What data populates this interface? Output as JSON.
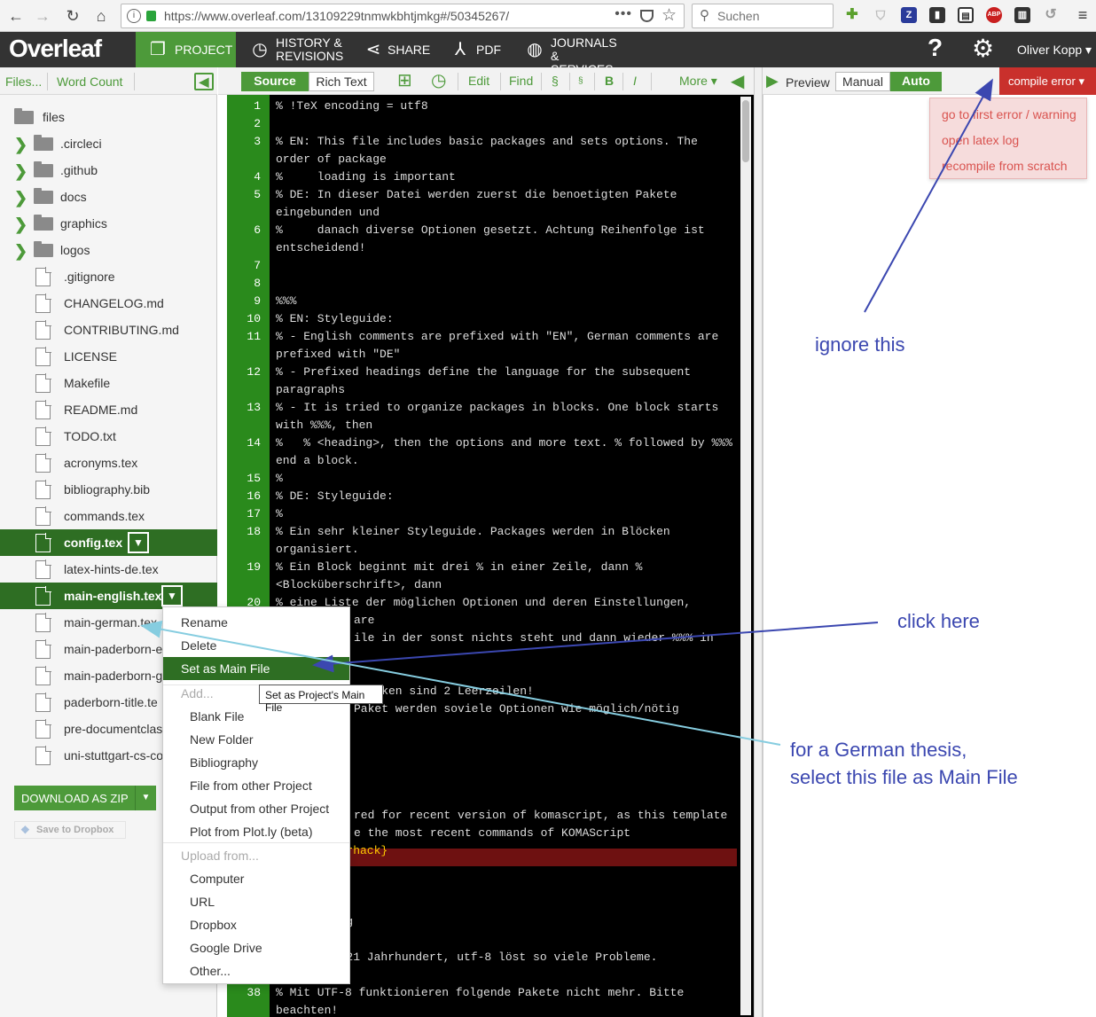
{
  "browser": {
    "url": "https://www.overleaf.com/13109229tnmwkbhtjmkg#/50345267/",
    "search_placeholder": "Suchen",
    "ext_z": "Z",
    "ext_abp": "ABP",
    "menu_glyph": "≡"
  },
  "topbar": {
    "logo": "Overleaf",
    "project": "PROJECT",
    "history_line1": "HISTORY &",
    "history_line2": "REVISIONS",
    "share": "SHARE",
    "pdf": "PDF",
    "journals_line1": "JOURNALS",
    "journals_line2": "& SERVICES",
    "help": "?",
    "user": "Oliver Kopp ▾"
  },
  "filetree": {
    "files_btn": "Files...",
    "wordcount_btn": "Word Count",
    "root": "files",
    "folders": [
      ".circleci",
      ".github",
      "docs",
      "graphics",
      "logos"
    ],
    "files": [
      ".gitignore",
      "CHANGELOG.md",
      "CONTRIBUTING.md",
      "LICENSE",
      "Makefile",
      "README.md",
      "TODO.txt",
      "acronyms.tex",
      "bibliography.bib",
      "commands.tex",
      "config.tex",
      "latex-hints-de.tex",
      "main-english.tex",
      "main-german.tex",
      "main-paderborn-e",
      "main-paderborn-g",
      "paderborn-title.te",
      "pre-documentclas",
      "uni-stuttgart-cs-co"
    ],
    "download_zip": "DOWNLOAD AS ZIP",
    "save_dropbox": "Save to Dropbox"
  },
  "editor": {
    "source": "Source",
    "richtext": "Rich Text",
    "edit": "Edit",
    "find": "Find",
    "section": "§",
    "subsection": "§",
    "bold": "B",
    "italic": "I",
    "more": "More ▾",
    "line_numbers": [
      "1",
      "2",
      "3",
      "",
      "4",
      "5",
      "",
      "6",
      "",
      "7",
      "8",
      "9",
      "10",
      "11",
      "",
      "12",
      "",
      "13",
      "",
      "14",
      "",
      "15",
      "16",
      "17",
      "18",
      "",
      "19",
      "",
      "20",
      "",
      "",
      "",
      "",
      "",
      "",
      "",
      "",
      "",
      "",
      "",
      "",
      "",
      "",
      "",
      "",
      "",
      "",
      "",
      "",
      "",
      "38",
      ""
    ],
    "lines": [
      {
        "n": "1",
        "text": "% !TeX encoding = utf8"
      },
      {
        "n": "2",
        "text": ""
      },
      {
        "n": "3",
        "text": "% EN: This file includes basic packages and sets options. The order of package"
      },
      {
        "n": "4",
        "text": "%     loading is important"
      },
      {
        "n": "5",
        "text": "% DE: In dieser Datei werden zuerst die benoetigten Pakete eingebunden und"
      },
      {
        "n": "6",
        "text": "%     danach diverse Optionen gesetzt. Achtung Reihenfolge ist entscheidend!"
      },
      {
        "n": "7",
        "text": ""
      },
      {
        "n": "8",
        "text": ""
      },
      {
        "n": "9",
        "text": "%%%"
      },
      {
        "n": "10",
        "text": "% EN: Styleguide:"
      },
      {
        "n": "11",
        "text": "% - English comments are prefixed with \"EN\", German comments are prefixed with \"DE\""
      },
      {
        "n": "12",
        "text": "% - Prefixed headings define the language for the subsequent paragraphs"
      },
      {
        "n": "13",
        "text": "% - It is tried to organize packages in blocks. One block starts with %%%, then"
      },
      {
        "n": "14",
        "text": "%   % <heading>, then the options and more text. % followed by %%% end a block."
      },
      {
        "n": "15",
        "text": "%"
      },
      {
        "n": "16",
        "text": "% DE: Styleguide:"
      },
      {
        "n": "17",
        "text": "%"
      },
      {
        "n": "18",
        "text": "% Ein sehr kleiner Styleguide. Packages werden in Blöcken organisiert."
      },
      {
        "n": "19",
        "text": "% Ein Block beginnt mit drei % in einer Zeile, dann % <Blocküberschrift>, dann"
      },
      {
        "n": "20",
        "text": "% eine Liste der möglichen Optionen und deren Einstellungen, Gründe"
      }
    ],
    "partial": {
      "l_are": "are",
      "l_ile": "ile in der sonst nichts steht und dann wieder %%% in",
      "l_blocks": "Blöcken sind 2 Leerzeilen!",
      "l_paket": "Paket werden soviele Optionen wie möglich/nötig",
      "l_red": "red for recent version of komascript, as this template",
      "l_most": "e the most recent commands of KOMAScript",
      "l_scrhack": "{scrhack}",
      "l_rung": "rung",
      "l_utf": "im 21 Jahrhundert, utf-8 löst so viele Probleme.",
      "l_38": "% Mit UTF-8 funktionieren folgende Pakete nicht mehr. Bitte",
      "l_38b": "beachten!"
    }
  },
  "preview": {
    "label": "Preview",
    "manual": "Manual",
    "auto": "Auto",
    "compile_error": "compile error ▾",
    "error_menu": [
      "go to first error / warning",
      "open latex log",
      "recompile from scratch"
    ]
  },
  "context_menu": {
    "rename": "Rename",
    "delete": "Delete",
    "set_main": "Set as Main File",
    "add": "Add...",
    "blank_file": "Blank File",
    "new_folder": "New Folder",
    "bibliography": "Bibliography",
    "file_from_project": "File from other Project",
    "output_from_project": "Output from other Project",
    "plotly": "Plot from Plot.ly (beta)",
    "upload_from": "Upload from...",
    "computer": "Computer",
    "url": "URL",
    "dropbox": "Dropbox",
    "google_drive": "Google Drive",
    "other": "Other...",
    "tooltip": "Set as Project's Main File"
  },
  "annotations": {
    "ignore": "ignore this",
    "click": "click here",
    "german_line1": "for a German thesis,",
    "german_line2": "select this file as Main File",
    "color_dark": "#3b47b0",
    "color_light": "#86cde0"
  },
  "colors": {
    "green": "#4d9a3a",
    "dark_green": "#2e6e23",
    "error_red": "#c9302c"
  }
}
